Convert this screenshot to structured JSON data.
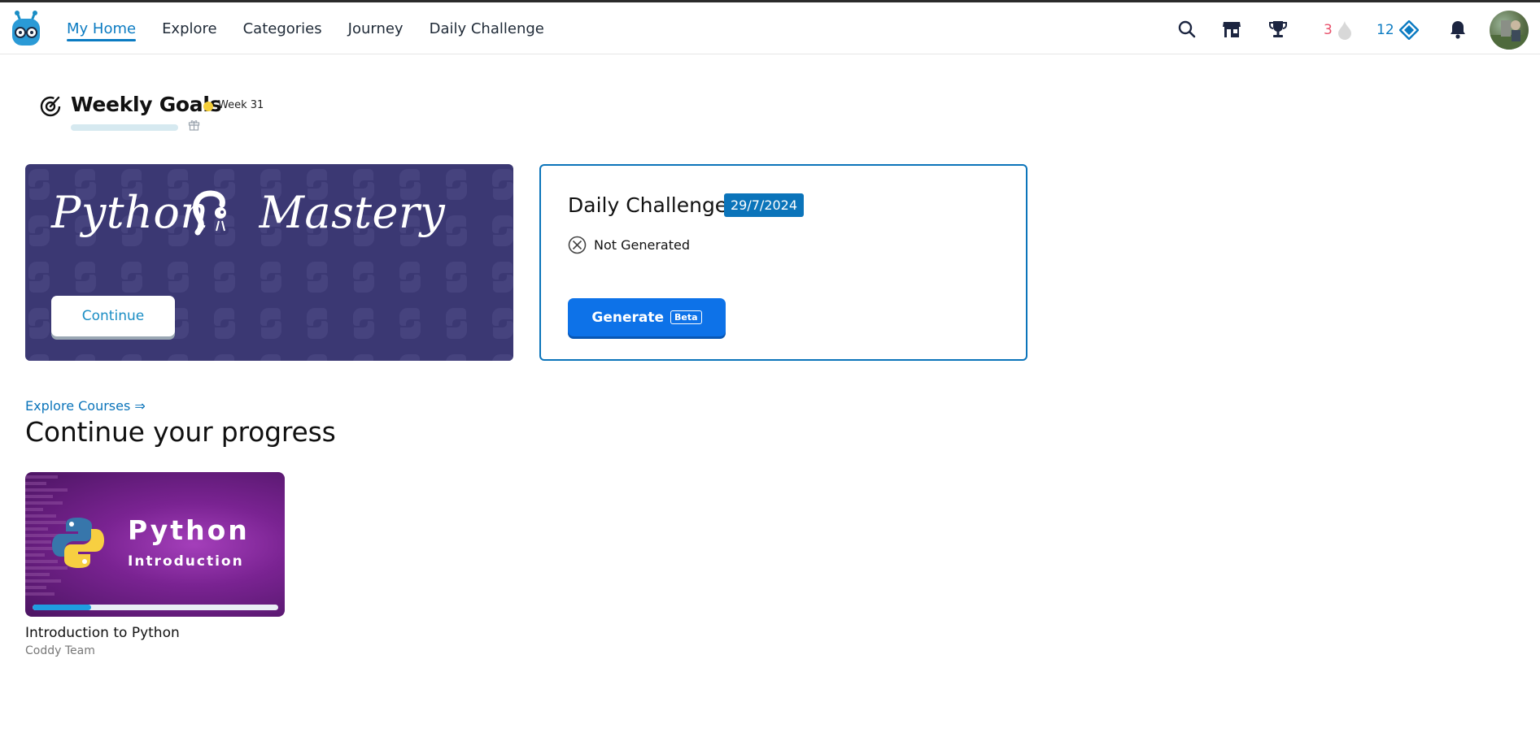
{
  "nav": {
    "items": [
      {
        "label": "My Home",
        "active": true
      },
      {
        "label": "Explore",
        "active": false
      },
      {
        "label": "Categories",
        "active": false
      },
      {
        "label": "Journey",
        "active": false
      },
      {
        "label": "Daily Challenge",
        "active": false
      }
    ]
  },
  "toolbar": {
    "icons": [
      "search-icon",
      "store-icon",
      "trophy-icon",
      "bell-icon"
    ],
    "streak_count": "3",
    "gems_count": "12"
  },
  "weekly_goals": {
    "title": "Weekly Goals",
    "week_label": "Week 31",
    "progress": 0
  },
  "banner": {
    "title_part1": "Python",
    "title_part2": "Mastery",
    "continue_label": "Continue"
  },
  "daily_challenge": {
    "title": "Daily Challenge",
    "date": "29/7/2024",
    "status": "Not Generated",
    "generate_label": "Generate",
    "beta_label": "Beta"
  },
  "progress_section": {
    "explore_link": "Explore Courses ⇒",
    "heading": "Continue your progress",
    "courses": [
      {
        "image_title": "Python",
        "image_subtitle": "Introduction",
        "name": "Introduction to Python",
        "author": "Coddy Team",
        "progress": 0.24
      }
    ]
  },
  "colors": {
    "accent": "#0b7bc2",
    "streak": "#e8506b",
    "banner_bg": "#3b3873",
    "generate_bg": "#0d72e8"
  }
}
